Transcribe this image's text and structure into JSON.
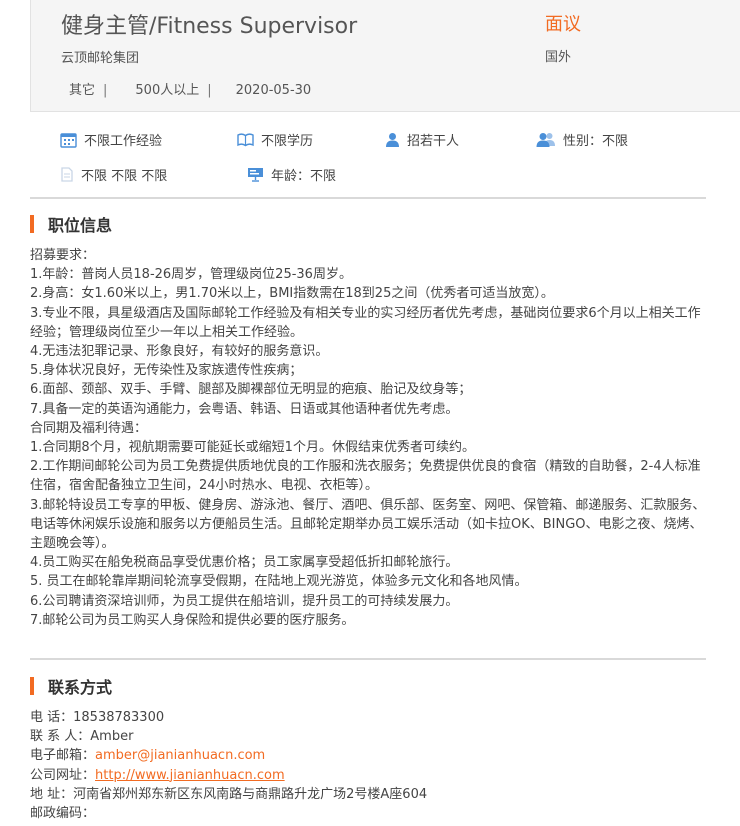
{
  "header": {
    "title": "健身主管/Fitness Supervisor",
    "company": "云顶邮轮集团",
    "category": "其它",
    "size": "500人以上",
    "date": "2020-05-30",
    "separator": "|",
    "salary": "面议",
    "location": "国外"
  },
  "tags": {
    "experience": "不限工作经验",
    "education": "不限学历",
    "headcount": "招若干人",
    "gender": "性别：不限",
    "other": "不限 不限 不限",
    "age": "年龄：不限"
  },
  "colors": {
    "accent": "#f26b22",
    "icon_blue": "#4a8fd8"
  },
  "job_section": {
    "title": "职位信息",
    "lines": [
      "招募要求：",
      "1.年龄：普岗人员18-26周岁，管理级岗位25-36周岁。",
      "2.身高：女1.60米以上，男1.70米以上，BMI指数需在18到25之间（优秀者可适当放宽）。",
      "3.专业不限，具星级酒店及国际邮轮工作经验及有相关专业的实习经历者优先考虑，基础岗位要求6个月以上相关工作经验；管理级岗位至少一年以上相关工作经验。",
      "4.无违法犯罪记录、形象良好，有较好的服务意识。",
      "5.身体状况良好，无传染性及家族遗传性疾病；",
      "6.面部、颈部、双手、手臂、腿部及脚裸部位无明显的疤痕、胎记及纹身等；",
      "7.具备一定的英语沟通能力，会粤语、韩语、日语或其他语种者优先考虑。",
      "合同期及福利待遇：",
      "1.合同期8个月，视航期需要可能延长或缩短1个月。休假结束优秀者可续约。",
      "2.工作期间邮轮公司为员工免费提供质地优良的工作服和洗衣服务；免费提供优良的食宿（精致的自助餐，2-4人标准住宿，宿舍配备独立卫生间，24小时热水、电视、衣柜等）。",
      "3.邮轮特设员工专享的甲板、健身房、游泳池、餐厅、酒吧、俱乐部、医务室、网吧、保管箱、邮递服务、汇款服务、电话等休闲娱乐设施和服务以方便船员生活。且邮轮定期举办员工娱乐活动（如卡拉OK、BINGO、电影之夜、烧烤、主题晚会等）。",
      "4.员工购买在船免税商品享受优惠价格；员工家属享受超低折扣邮轮旅行。",
      "5. 员工在邮轮靠岸期间轮流享受假期，在陆地上观光游览，体验多元文化和各地风情。",
      "6.公司聘请资深培训师，为员工提供在船培训，提升员工的可持续发展力。",
      "7.邮轮公司为员工购买人身保险和提供必要的医疗服务。"
    ]
  },
  "contact_section": {
    "title": "联系方式",
    "phone_label": "电  话：",
    "phone": "18538783300",
    "person_label": "联 系 人：",
    "person": "Amber",
    "email_label": "电子邮箱：",
    "email": "amber@jianianhuacn.com",
    "website_label": "公司网址：",
    "website": "http://www.jianianhuacn.com",
    "address_label": "地  址：",
    "address": "河南省郑州郑东新区东风南路与商鼎路升龙广场2号楼A座604",
    "postcode_label": "邮政编码："
  }
}
